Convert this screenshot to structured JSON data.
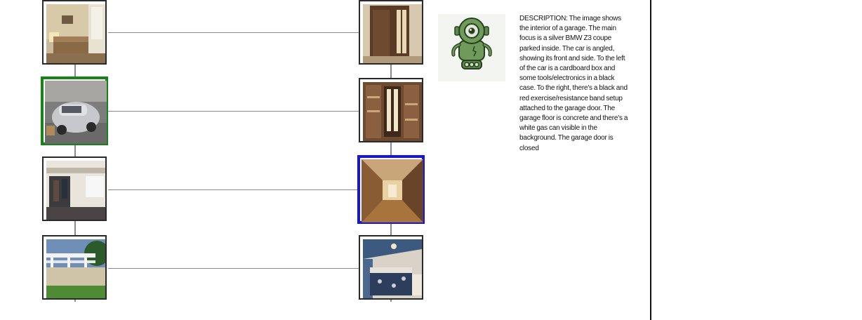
{
  "left_column": [
    {
      "name": "living-room",
      "selected": false
    },
    {
      "name": "garage",
      "selected": true,
      "highlight": "#168316"
    },
    {
      "name": "mudroom",
      "selected": false
    },
    {
      "name": "patio-pergola",
      "selected": false
    }
  ],
  "right_column": [
    {
      "name": "front-door",
      "selected": false
    },
    {
      "name": "closet",
      "selected": false
    },
    {
      "name": "hallway",
      "selected": true,
      "highlight": "#1414e6"
    },
    {
      "name": "bedroom",
      "selected": false
    }
  ],
  "assistant": {
    "icon": "robot-icon",
    "description": "DESCRIPTION: The image shows the interior of a garage. The main focus is a silver BMW Z3 coupe parked inside. The car is angled, showing its front and side. To the left of the car is a cardboard box and some tools/electronics in a black case. To the right, there's a black and red exercise/resistance band setup attached to the garage door. The garage floor is concrete and there's a white gas can visible in the background. The garage door is closed"
  },
  "colors": {
    "connector": "#8a8a8a",
    "selected_left": "#168316",
    "selected_right": "#1414e6",
    "divider": "#111111"
  }
}
